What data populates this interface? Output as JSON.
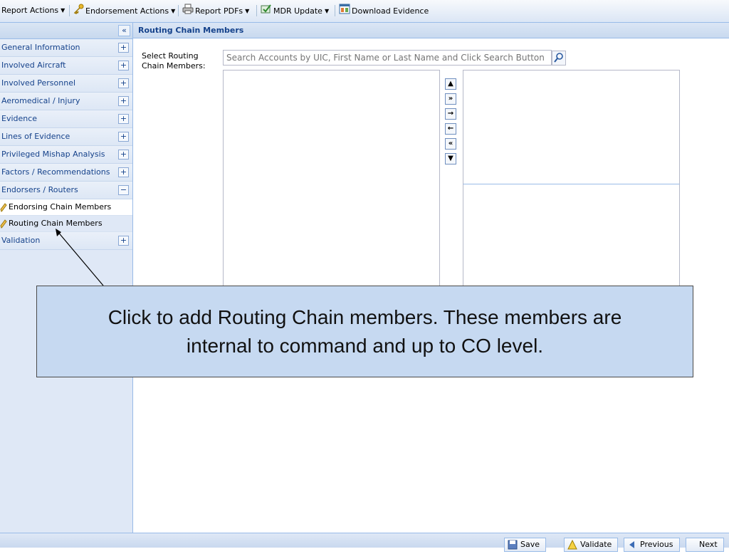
{
  "toolbar": {
    "report_actions": "Report Actions",
    "endorsement_actions": "Endorsement Actions",
    "report_pdfs": "Report PDFs",
    "mdr_update": "MDR Update",
    "download_evidence": "Download Evidence"
  },
  "nav": {
    "collapse_symbol": "«",
    "items": [
      {
        "label": "General Information",
        "symbol": "+"
      },
      {
        "label": "Involved Aircraft",
        "symbol": "+"
      },
      {
        "label": "Involved Personnel",
        "symbol": "+"
      },
      {
        "label": "Aeromedical / Injury",
        "symbol": "+"
      },
      {
        "label": "Evidence",
        "symbol": "+"
      },
      {
        "label": "Lines of Evidence",
        "symbol": "+"
      },
      {
        "label": "Privileged Mishap Analysis",
        "symbol": "+"
      },
      {
        "label": "Factors / Recommendations",
        "symbol": "+"
      },
      {
        "label": "Endorsers / Routers",
        "symbol": "−"
      }
    ],
    "sub_items": [
      {
        "label": "Endorsing Chain Members"
      },
      {
        "label": "Routing Chain Members"
      }
    ],
    "after": {
      "label": "Validation",
      "symbol": "+"
    }
  },
  "main": {
    "title": "Routing Chain Members",
    "field_label": "Select Routing Chain Members:",
    "search_placeholder": "Search Accounts by UIC, First Name or Last Name and Click Search Button",
    "arrows": [
      "▲",
      "»",
      "→",
      "←",
      "«",
      "▼"
    ]
  },
  "footer": {
    "save": "Save",
    "validate": "Validate",
    "previous": "Previous",
    "next": "Next"
  },
  "callout": {
    "text": "Click to add Routing Chain members.  These members are internal to command and up to CO level."
  },
  "colors": {
    "accent": "#15428b",
    "panel_border": "#99bbe8",
    "nav_bg": "#dfe8f6",
    "callout_bg": "#c6d9f1"
  }
}
